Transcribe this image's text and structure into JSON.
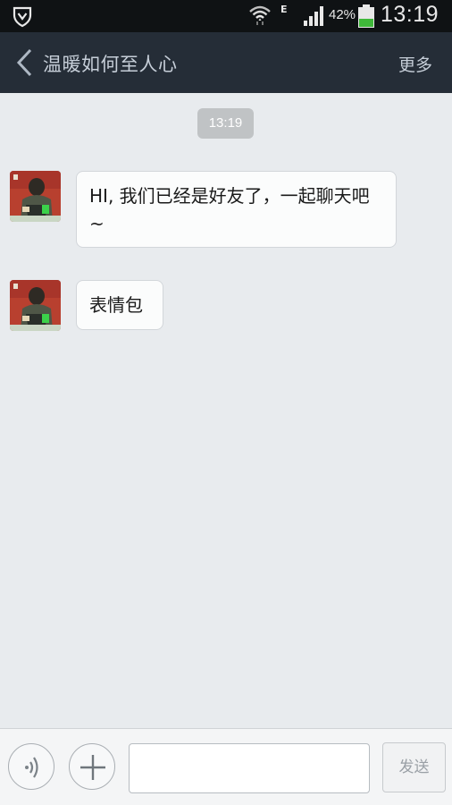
{
  "status_bar": {
    "network": "E",
    "battery_percent": "42%",
    "battery_level": 0.42,
    "time": "13:19",
    "icons": [
      "shield-icon",
      "wifi-icon",
      "signal-icon",
      "battery-icon"
    ]
  },
  "header": {
    "title": "温暖如何至人心",
    "more_label": "更多",
    "back_icon": "chevron-left-icon"
  },
  "chat": {
    "timestamp": "13:19",
    "messages": [
      {
        "sender": "contact",
        "text": "HI, 我们已经是好友了，一起聊天吧~"
      },
      {
        "sender": "contact",
        "text": "表情包"
      }
    ]
  },
  "input_bar": {
    "voice_icon": "voice-icon",
    "add_icon": "plus-icon",
    "text_value": "",
    "send_label": "发送"
  },
  "colors": {
    "header_bg": "#252d37",
    "status_bg": "#0f1214",
    "chat_bg": "#e8ebee",
    "battery_fill": "#3fb83a"
  }
}
